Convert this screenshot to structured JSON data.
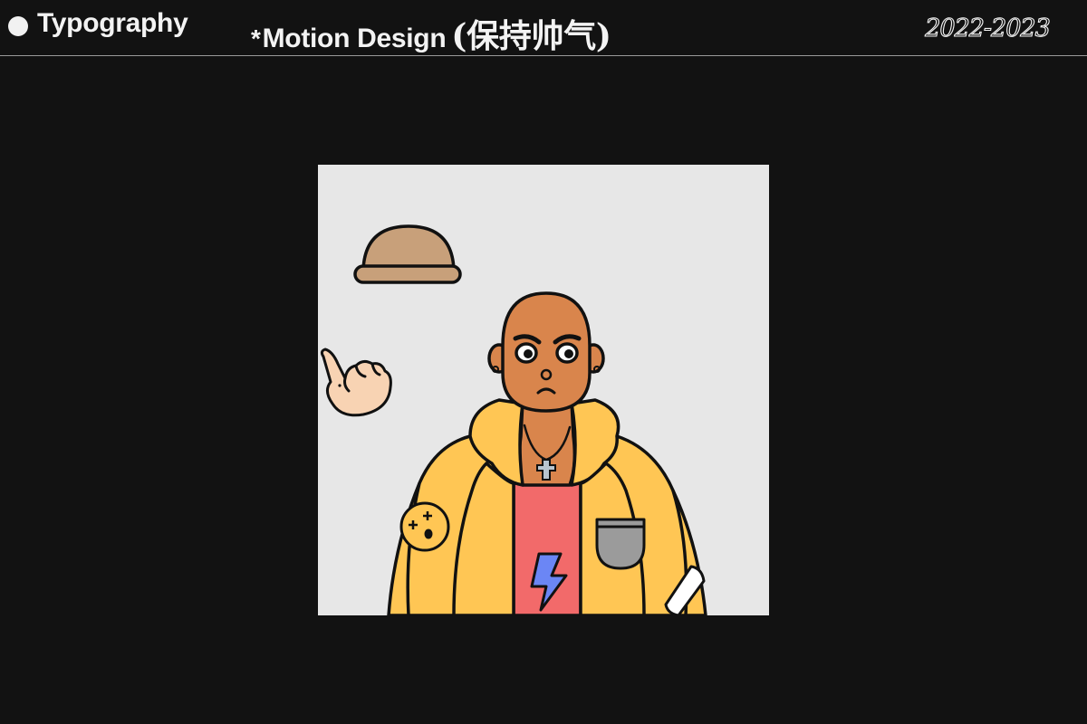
{
  "header": {
    "nav_typography": "Typography",
    "nav_motion_star": "*",
    "nav_motion": "Motion Design",
    "nav_motion_cn": "(保持帅气)",
    "years": "2022-2023"
  },
  "colors": {
    "background": "#121212",
    "text": "#f3f3f3",
    "canvas_bg": "#e7e7e7",
    "skin": "#d9854c",
    "jacket": "#ffc654",
    "shirt": "#f26a6a",
    "bolt": "#6b86f5",
    "hat": "#c8a07a",
    "hand": "#f8d3b3",
    "pocket": "#9b9b9b"
  },
  "illustration": {
    "subject": "bald-man-in-yellow-jacket",
    "icons": [
      "bowler-hat-icon",
      "pinching-hand-icon",
      "cross-necklace-icon",
      "lightning-bolt-icon",
      "dizzy-face-patch-icon"
    ]
  }
}
